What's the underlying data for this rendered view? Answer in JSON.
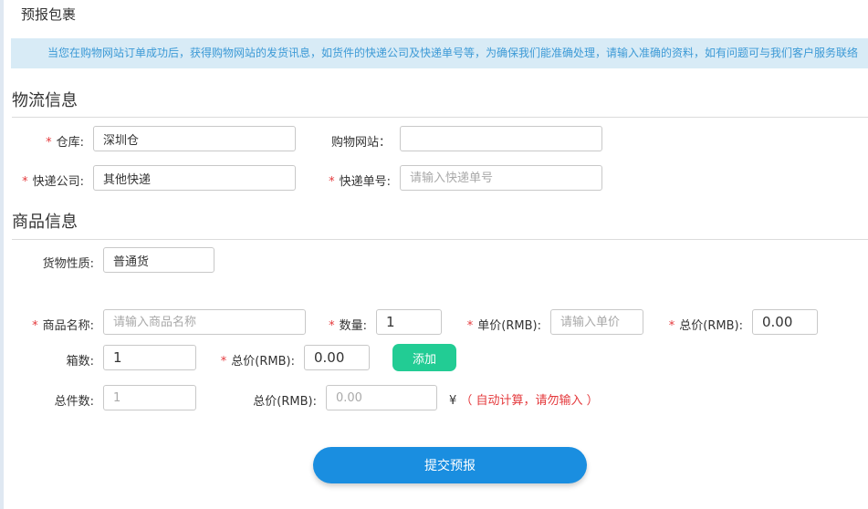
{
  "page_title": "预报包裹",
  "notice": "当您在购物网站订单成功后，获得购物网站的发货讯息，如货件的快递公司及快递单号等，为确保我们能准确处理，请输入准确的资料，如有问题可与我们客户服务联络",
  "logistics": {
    "title": "物流信息",
    "warehouse_label": "仓库:",
    "warehouse_value": "深圳仓",
    "shop_site_label": "购物网站：",
    "shop_site_value": "",
    "courier_label": "快递公司:",
    "courier_value": "其他快递",
    "tracking_label": "快递单号:",
    "tracking_placeholder": "请输入快递单号"
  },
  "goods": {
    "title": "商品信息",
    "nature_label": "货物性质:",
    "nature_value": "普通货",
    "name_label": "商品名称:",
    "name_placeholder": "请输入商品名称",
    "qty_label": "数量:",
    "qty_value": "1",
    "unit_price_label": "单价(RMB):",
    "unit_price_placeholder": "请输入单价",
    "total_label": "总价(RMB):",
    "total_value": "0.00",
    "boxes_label": "箱数:",
    "boxes_value": "1",
    "box_total_label": "总价(RMB):",
    "box_total_value": "0.00",
    "add_label": "添加",
    "total_pieces_label": "总件数:",
    "total_pieces_value": "1",
    "grand_total_label": "总价(RMB):",
    "grand_total_value": "0.00",
    "currency": "¥",
    "auto_note": "（ 自动计算，请勿输入 ）"
  },
  "submit_label": "提交预报",
  "required_mark": "*"
}
